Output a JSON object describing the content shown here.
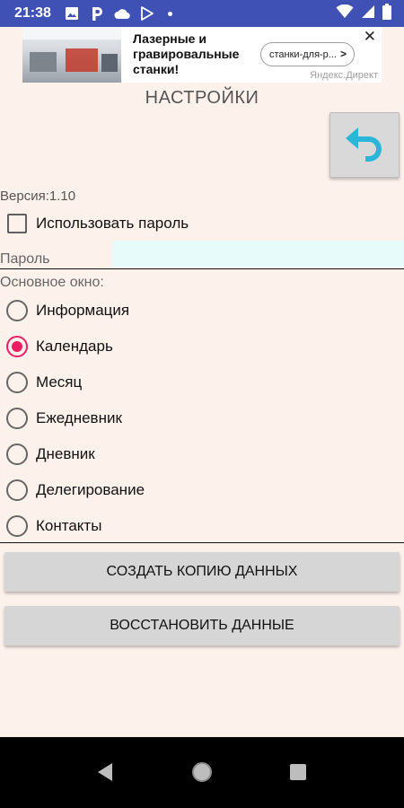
{
  "status_bar": {
    "time": "21:38",
    "icons": [
      "image-icon",
      "p-app-icon",
      "cloud-icon",
      "play-store-icon",
      "dot-icon",
      "wifi-icon",
      "signal-icon",
      "battery-icon"
    ]
  },
  "ad": {
    "title": "Лазерные и гравировальные станки!",
    "link_text": "станки-для-р...",
    "source": "Яндекс.Директ"
  },
  "header": {
    "title": "НАСТРОЙКИ"
  },
  "settings": {
    "version": "Версия:1.10",
    "use_password_label": "Использовать пароль",
    "use_password_checked": false,
    "password_label": "Пароль",
    "password_value": "",
    "main_window_label": "Основное окно:",
    "main_window_options": [
      {
        "label": "Информация",
        "selected": false
      },
      {
        "label": "Календарь",
        "selected": true
      },
      {
        "label": "Месяц",
        "selected": false
      },
      {
        "label": "Ежедневник",
        "selected": false
      },
      {
        "label": "Дневник",
        "selected": false
      },
      {
        "label": "Делегирование",
        "selected": false
      },
      {
        "label": "Контакты",
        "selected": false
      }
    ]
  },
  "actions": {
    "backup_label": "СОЗДАТЬ КОПИЮ ДАННЫХ",
    "restore_label": "ВОССТАНОВИТЬ ДАННЫЕ"
  },
  "colors": {
    "status_bar": "#3f51b5",
    "background": "#fdf1ec",
    "accent": "#e91e63",
    "back_arrow": "#29b6d8"
  }
}
